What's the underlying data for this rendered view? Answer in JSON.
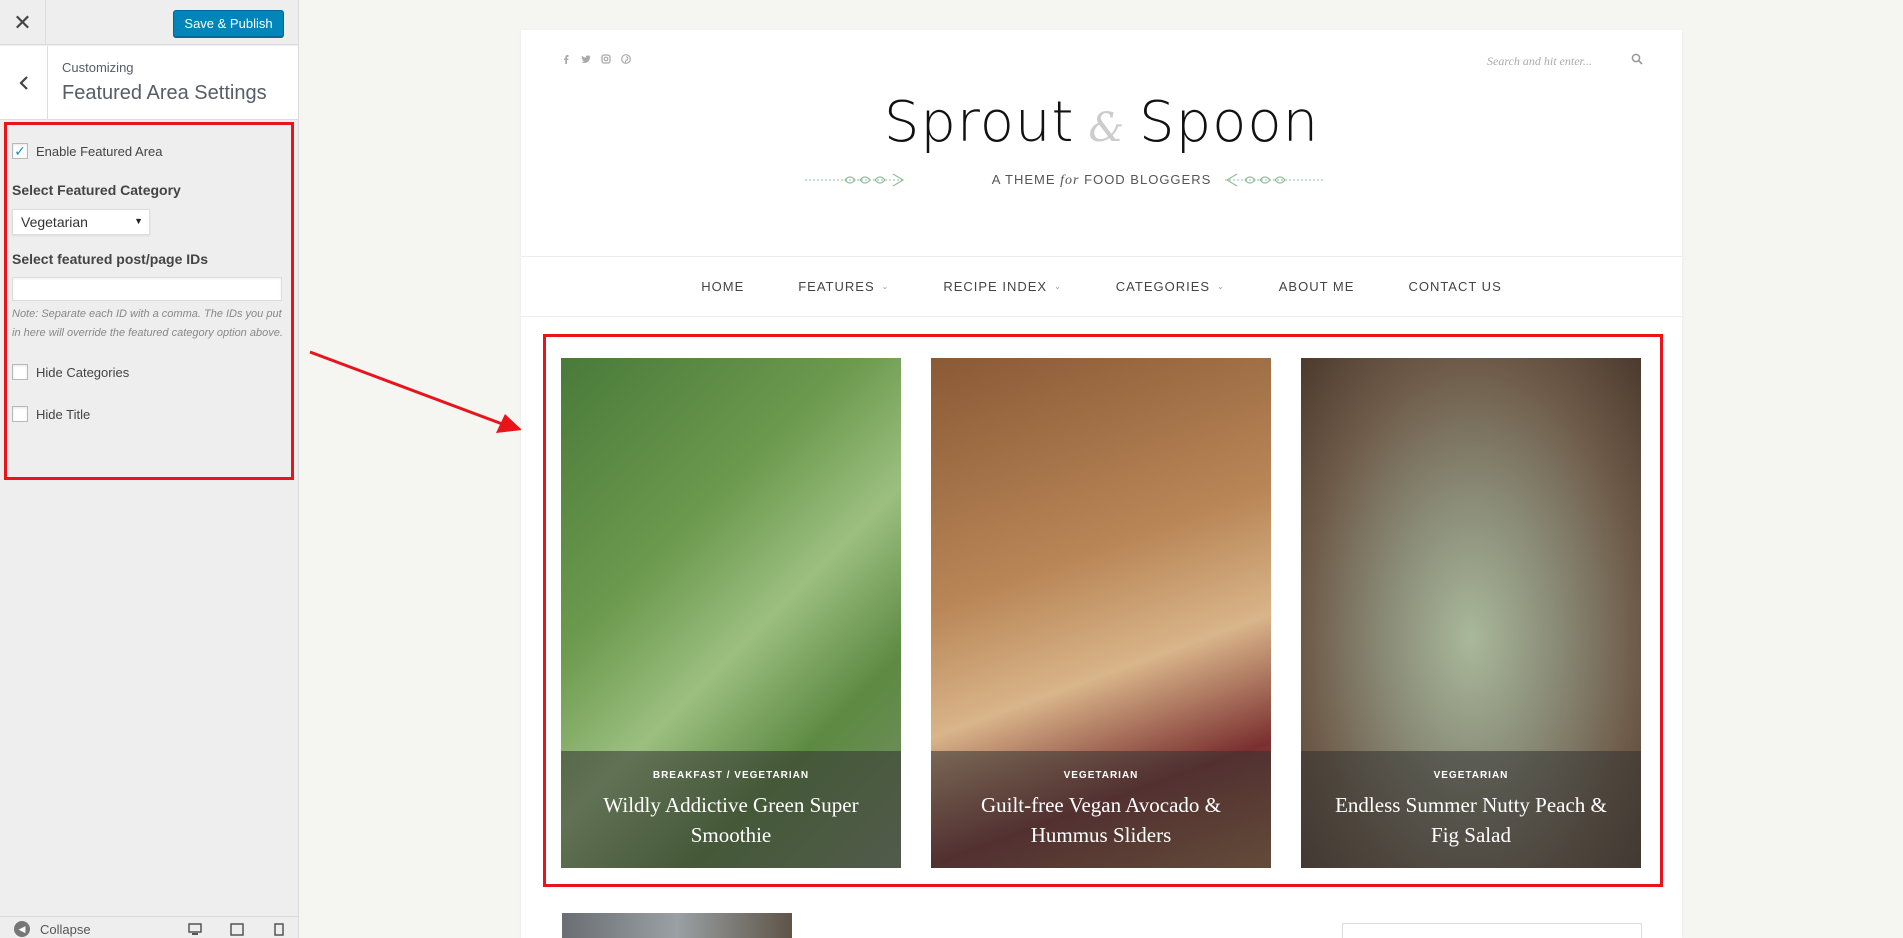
{
  "topbar": {
    "close_icon": "close-icon",
    "save_label": "Save & Publish"
  },
  "section": {
    "back_icon": "chevron-left-icon",
    "customizing_label": "Customizing",
    "title": "Featured Area Settings"
  },
  "settings": {
    "enable_label": "Enable Featured Area",
    "enable_checked": true,
    "category_label": "Select Featured Category",
    "category_value": "Vegetarian",
    "ids_label": "Select featured post/page IDs",
    "ids_value": "",
    "note": "Note: Separate each ID with a comma. The IDs you put in here will override the featured category option above.",
    "hide_categories_label": "Hide Categories",
    "hide_categories_checked": false,
    "hide_title_label": "Hide Title",
    "hide_title_checked": false
  },
  "footer": {
    "collapse_label": "Collapse",
    "devices": [
      "desktop-icon",
      "tablet-icon",
      "mobile-icon"
    ]
  },
  "preview": {
    "social_icons": [
      "facebook-icon",
      "twitter-icon",
      "instagram-icon",
      "pinterest-icon"
    ],
    "search_placeholder": "Search and hit enter...",
    "logo_left": "Sprout",
    "logo_amp": "&",
    "logo_right": "Spoon",
    "tagline_a": "A THEME",
    "tagline_em": "for",
    "tagline_b": "FOOD BLOGGERS",
    "nav": [
      {
        "label": "HOME"
      },
      {
        "label": "FEATURES"
      },
      {
        "label": "RECIPE INDEX"
      },
      {
        "label": "CATEGORIES"
      },
      {
        "label": "ABOUT ME"
      },
      {
        "label": "CONTACT US"
      }
    ],
    "featured": [
      {
        "categories": "BREAKFAST / VEGETARIAN",
        "title": "Wildly Addictive Green Super Smoothie"
      },
      {
        "categories": "VEGETARIAN",
        "title": "Guilt-free Vegan Avocado & Hummus Sliders"
      },
      {
        "categories": "VEGETARIAN",
        "title": "Endless Summer Nutty Peach & Fig Salad"
      }
    ]
  },
  "colors": {
    "accent": "#0085ba",
    "highlight": "#e8141c",
    "vine": "#8fbf9a"
  }
}
